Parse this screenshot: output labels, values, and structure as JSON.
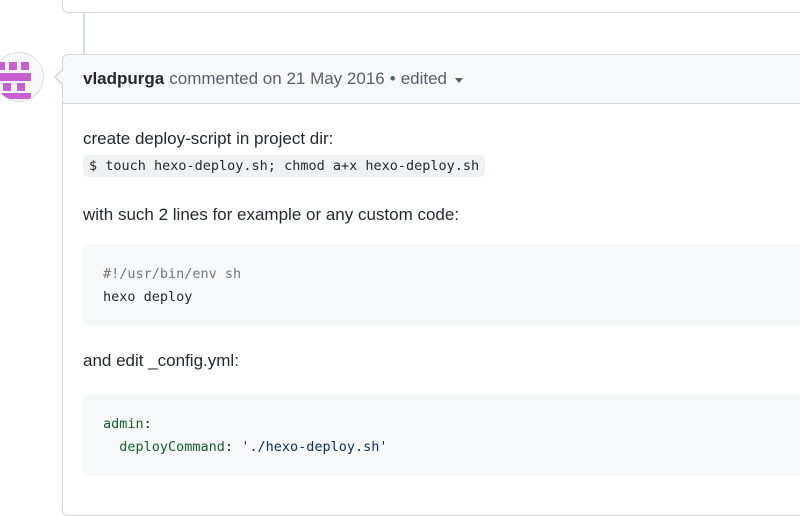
{
  "comment": {
    "author": "vladpurga",
    "action": "commented on",
    "date": "21 May 2016",
    "separator": "•",
    "edited_label": "edited"
  },
  "body": {
    "intro": "create deploy-script in project dir:",
    "inline_command": "$ touch hexo-deploy.sh; chmod a+x hexo-deploy.sh",
    "example_text": "with such 2 lines for example or any custom code:",
    "script_lines": [
      "#!/usr/bin/env sh",
      "hexo deploy"
    ],
    "config_text": "and edit _config.yml:",
    "config_key": "admin",
    "config_colon": ":",
    "config_subkey": "deployCommand",
    "config_sep": ": ",
    "config_value": "'./hexo-deploy.sh'"
  },
  "icons": {
    "avatar": "identicon-avatar",
    "edited_dropdown": "triangle-down-icon"
  },
  "colors": {
    "avatar_purple": "#c85fd1",
    "header_bg": "#f6f8fa",
    "border": "#d0d7de",
    "code_bg": "#f6f8fa"
  }
}
